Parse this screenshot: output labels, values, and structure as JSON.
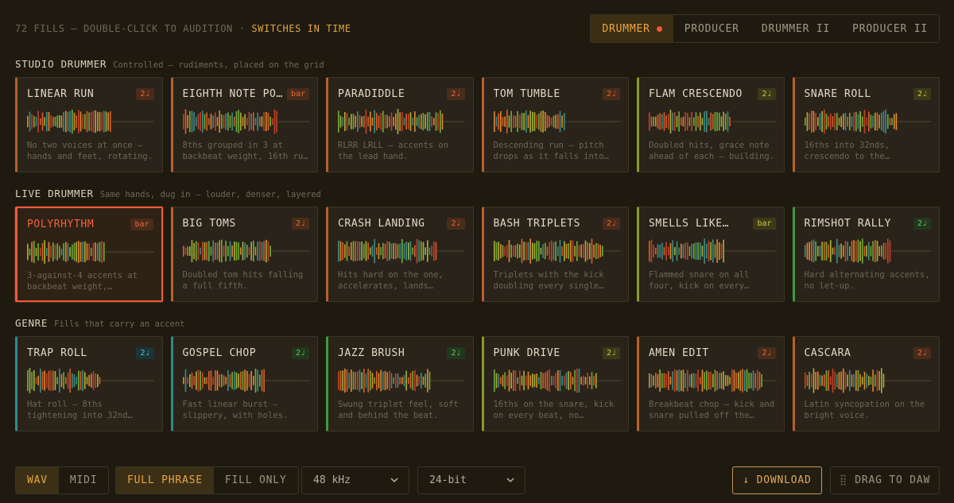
{
  "header": {
    "hint_prefix": "72 FILLS — DOUBLE-CLICK TO AUDITION ·",
    "hint_accent": "SWITCHES IN TIME",
    "modes": [
      {
        "label": "DRUMMER",
        "active": true
      },
      {
        "label": "PRODUCER",
        "active": false
      },
      {
        "label": "DRUMMER II",
        "active": false
      },
      {
        "label": "PRODUCER II",
        "active": false
      }
    ]
  },
  "colors": {
    "accent": "#f0a73a",
    "selected": "#ee5c3a",
    "orange_stripe": "#b8602c",
    "olive_stripe": "#8a9a2e",
    "teal_stripe": "#2f8a8e",
    "green_stripe": "#3f9a3c"
  },
  "sections": [
    {
      "title": "STUDIO DRUMMER",
      "subtitle": "Controlled — rudiments, placed on the grid",
      "cards": [
        {
          "title": "LINEAR RUN",
          "badge": "2♩",
          "badge_style": "orange",
          "stripe": "orange",
          "desc": "No two voices at once — hands and feet, rotating.",
          "selected": false
        },
        {
          "title": "EIGHTH NOTE PO…",
          "badge": "bar",
          "badge_style": "orange",
          "stripe": "orange",
          "desc": "8ths grouped in 3 at backbeat weight, 16th ru…",
          "selected": false
        },
        {
          "title": "PARADIDDLE",
          "badge": "2♩",
          "badge_style": "orange",
          "stripe": "orange",
          "desc": "RLRR LRLL — accents on the lead hand.",
          "selected": false
        },
        {
          "title": "TOM TUMBLE",
          "badge": "2♩",
          "badge_style": "orange",
          "stripe": "orange",
          "desc": "Descending run — pitch drops as it falls into…",
          "selected": false
        },
        {
          "title": "FLAM CRESCENDO",
          "badge": "2♩",
          "badge_style": "olive",
          "stripe": "olive",
          "desc": "Doubled hits, grace note ahead of each — building.",
          "selected": false
        },
        {
          "title": "SNARE ROLL",
          "badge": "2♩",
          "badge_style": "olive",
          "stripe": "orange",
          "desc": "16ths into 32nds, crescendo to the…",
          "selected": false
        }
      ]
    },
    {
      "title": "LIVE DRUMMER",
      "subtitle": "Same hands, dug in — louder, denser, layered",
      "cards": [
        {
          "title": "POLYRHYTHM",
          "badge": "bar",
          "badge_style": "orange",
          "stripe": "selected",
          "desc": "3-against-4 accents at backbeat weight,…",
          "selected": true
        },
        {
          "title": "BIG TOMS",
          "badge": "2♩",
          "badge_style": "orange",
          "stripe": "orange",
          "desc": "Doubled tom hits falling a full fifth.",
          "selected": false
        },
        {
          "title": "CRASH LANDING",
          "badge": "2♩",
          "badge_style": "orange",
          "stripe": "orange",
          "desc": "Hits hard on the one, accelerates, lands…",
          "selected": false
        },
        {
          "title": "BASH TRIPLETS",
          "badge": "2♩",
          "badge_style": "orange",
          "stripe": "orange",
          "desc": "Triplets with the kick doubling every single…",
          "selected": false
        },
        {
          "title": "SMELLS LIKE…",
          "badge": "bar",
          "badge_style": "olive",
          "stripe": "olive",
          "desc": "Flammed snare on all four, kick on every…",
          "selected": false
        },
        {
          "title": "RIMSHOT RALLY",
          "badge": "2♩",
          "badge_style": "green",
          "stripe": "green",
          "desc": "Hard alternating accents, no let-up.",
          "selected": false
        }
      ]
    },
    {
      "title": "GENRE",
      "subtitle": "Fills that carry an accent",
      "cards": [
        {
          "title": "TRAP ROLL",
          "badge": "2♩",
          "badge_style": "teal",
          "stripe": "teal",
          "desc": "Hat roll — 8ths tightening into 32nd…",
          "selected": false
        },
        {
          "title": "GOSPEL CHOP",
          "badge": "2♩",
          "badge_style": "green",
          "stripe": "teal",
          "desc": "Fast linear burst — slippery, with holes.",
          "selected": false
        },
        {
          "title": "JAZZ BRUSH",
          "badge": "2♩",
          "badge_style": "green",
          "stripe": "green",
          "desc": "Swung triplet feel, soft and behind the beat.",
          "selected": false
        },
        {
          "title": "PUNK DRIVE",
          "badge": "2♩",
          "badge_style": "olive",
          "stripe": "olive",
          "desc": "16ths on the snare, kick on every beat, no…",
          "selected": false
        },
        {
          "title": "AMEN EDIT",
          "badge": "2♩",
          "badge_style": "orange",
          "stripe": "orange",
          "desc": "Breakbeat chop — kick and snare pulled off the…",
          "selected": false
        },
        {
          "title": "CASCARA",
          "badge": "2♩",
          "badge_style": "orange",
          "stripe": "orange",
          "desc": "Latin syncopation on the bright voice.",
          "selected": false
        }
      ]
    }
  ],
  "footer": {
    "format": [
      {
        "label": "WAV",
        "on": true
      },
      {
        "label": "MIDI",
        "on": false
      }
    ],
    "range": [
      {
        "label": "FULL PHRASE",
        "on": true
      },
      {
        "label": "FILL ONLY",
        "on": false
      }
    ],
    "sample_rate": "48 kHz",
    "bit_depth": "24-bit",
    "download_label": "↓ DOWNLOAD",
    "drag_label": "DRAG TO DAW",
    "drag_icon": "drag-grip-icon"
  }
}
